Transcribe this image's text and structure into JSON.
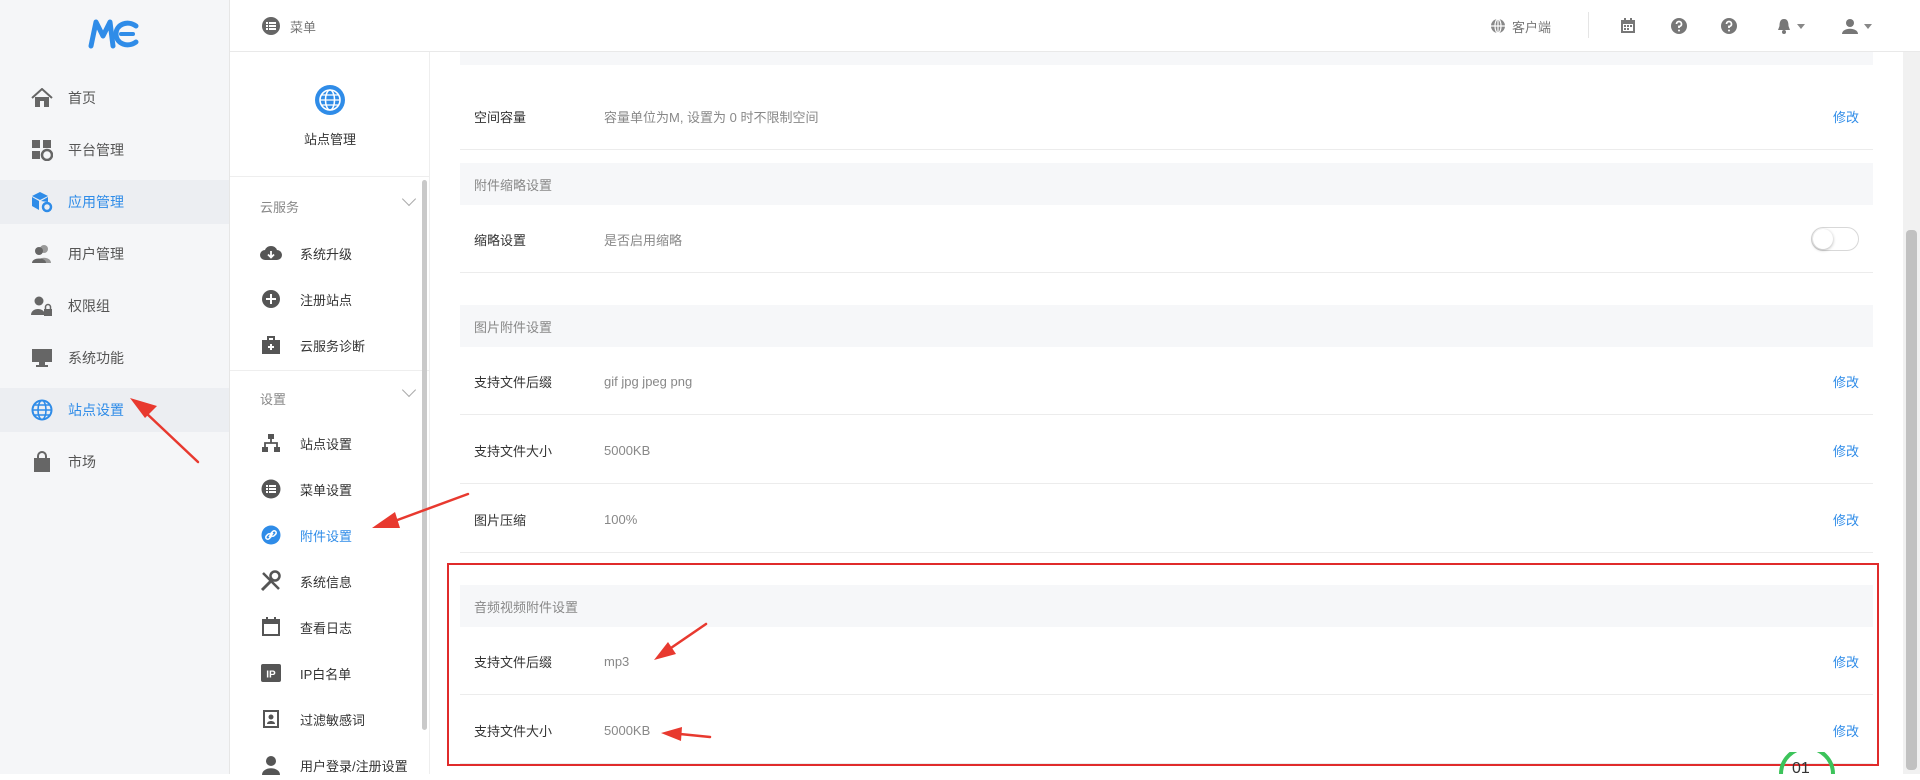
{
  "app": {
    "logo_text": "MCE"
  },
  "colors": {
    "accent": "#2f8ce8",
    "highlight": "#e02b2b"
  },
  "left_nav": {
    "items": [
      {
        "label": "首页",
        "icon": "home-icon"
      },
      {
        "label": "平台管理",
        "icon": "grid-gear-icon"
      },
      {
        "label": "应用管理",
        "icon": "box-gear-icon",
        "active": true
      },
      {
        "label": "用户管理",
        "icon": "users-icon"
      },
      {
        "label": "权限组",
        "icon": "user-lock-icon"
      },
      {
        "label": "系统功能",
        "icon": "monitor-icon"
      },
      {
        "label": "站点设置",
        "icon": "globe-icon"
      },
      {
        "label": "市场",
        "icon": "shopping-bag-icon"
      }
    ]
  },
  "topbar": {
    "menu_label": "菜单",
    "client_label": "客户端"
  },
  "sub_nav": {
    "header_title": "站点管理",
    "groups": [
      {
        "title": "云服务",
        "items": [
          {
            "label": "系统升级",
            "icon": "cloud-download-icon"
          },
          {
            "label": "注册站点",
            "icon": "plus-circle-icon"
          },
          {
            "label": "云服务诊断",
            "icon": "medkit-icon"
          }
        ]
      },
      {
        "title": "设置",
        "items": [
          {
            "label": "站点设置",
            "icon": "sitemap-icon"
          },
          {
            "label": "菜单设置",
            "icon": "list-icon"
          },
          {
            "label": "附件设置",
            "icon": "link-icon",
            "active": true
          },
          {
            "label": "系统信息",
            "icon": "wrench-icon"
          },
          {
            "label": "查看日志",
            "icon": "calendar-icon"
          },
          {
            "label": "IP白名单",
            "icon": "ip-icon"
          },
          {
            "label": "过滤敏感词",
            "icon": "address-book-icon"
          },
          {
            "label": "用户登录/注册设置",
            "icon": "user-icon"
          }
        ]
      }
    ]
  },
  "main": {
    "space_row": {
      "label": "空间容量",
      "value": "容量单位为M, 设置为 0 时不限制空间",
      "action": "修改"
    },
    "thumb_section": {
      "title": "附件缩略设置",
      "rows": [
        {
          "label": "缩略设置",
          "value": "是否启用缩略",
          "toggle_on": false
        }
      ]
    },
    "image_section": {
      "title": "图片附件设置",
      "rows": [
        {
          "label": "支持文件后缀",
          "value": "gif jpg jpeg png",
          "action": "修改"
        },
        {
          "label": "支持文件大小",
          "value": "5000KB",
          "action": "修改"
        },
        {
          "label": "图片压缩",
          "value": "100%",
          "action": "修改"
        }
      ]
    },
    "media_section": {
      "title": "音频视频附件设置",
      "rows": [
        {
          "label": "支持文件后缀",
          "value": "mp3",
          "action": "修改"
        },
        {
          "label": "支持文件大小",
          "value": "5000KB",
          "action": "修改"
        }
      ]
    }
  },
  "loader_text": "01"
}
